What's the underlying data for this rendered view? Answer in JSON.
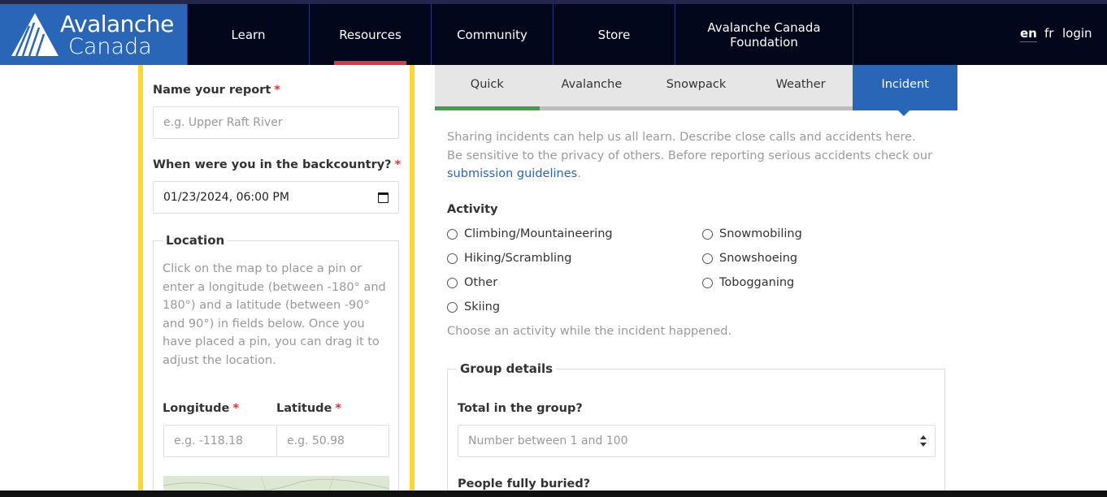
{
  "header": {
    "logo": {
      "line1": "Avalanche",
      "line2": "Canada"
    },
    "nav": [
      {
        "label": "Learn"
      },
      {
        "label": "Resources"
      },
      {
        "label": "Community"
      },
      {
        "label": "Store"
      },
      {
        "label": "Avalanche Canada Foundation"
      }
    ],
    "active_nav": "Resources",
    "lang_en": "en",
    "lang_fr": "fr",
    "login": "login",
    "colors": {
      "header_bg": "#03071b",
      "logo_bg": "#2a66b8",
      "active_indicator": "#e0363a"
    }
  },
  "left_form": {
    "name_label": "Name your report",
    "name_placeholder": "e.g. Upper Raft River",
    "when_label": "When were you in the backcountry?",
    "when_value": "01/23/2024, 06:00 PM",
    "required_mark": "*",
    "location_legend": "Location",
    "location_help": "Click on the map to place a pin or enter a longitude (between -180° and 180°) and a latitude (between -90° and 90°) in fields below. Once you have placed a pin, you can drag it to adjust the location.",
    "longitude_label": "Longitude",
    "longitude_placeholder": "e.g. -118.18",
    "latitude_label": "Latitude",
    "latitude_placeholder": "e.g. 50.98",
    "panel_border_color": "#fdd835"
  },
  "tabs": [
    {
      "label": "Quick",
      "bar_color": "#43a047"
    },
    {
      "label": "Avalanche",
      "bar_color": "#bdbdbd"
    },
    {
      "label": "Snowpack",
      "bar_color": "#bdbdbd"
    },
    {
      "label": "Weather",
      "bar_color": "#bdbdbd"
    },
    {
      "label": "Incident",
      "bar_color": "#2a66b8"
    }
  ],
  "active_tab": "Incident",
  "incident": {
    "intro_text": "Sharing incidents can help us all learn. Describe close calls and accidents here. Be sensitive to the privacy of others. Before reporting serious accidents check our ",
    "intro_link": "submission guidelines",
    "intro_end": ".",
    "activity_label": "Activity",
    "activities_col1": [
      "Climbing/Mountaineering",
      "Hiking/Scrambling",
      "Other",
      "Skiing"
    ],
    "activities_col2": [
      "Snowmobiling",
      "Snowshoeing",
      "Tobogganing"
    ],
    "activity_hint": "Choose an activity while the incident happened.",
    "group_legend": "Group details",
    "total_label": "Total in the group?",
    "total_placeholder": "Number between 1 and 100",
    "buried_label": "People fully buried?"
  }
}
